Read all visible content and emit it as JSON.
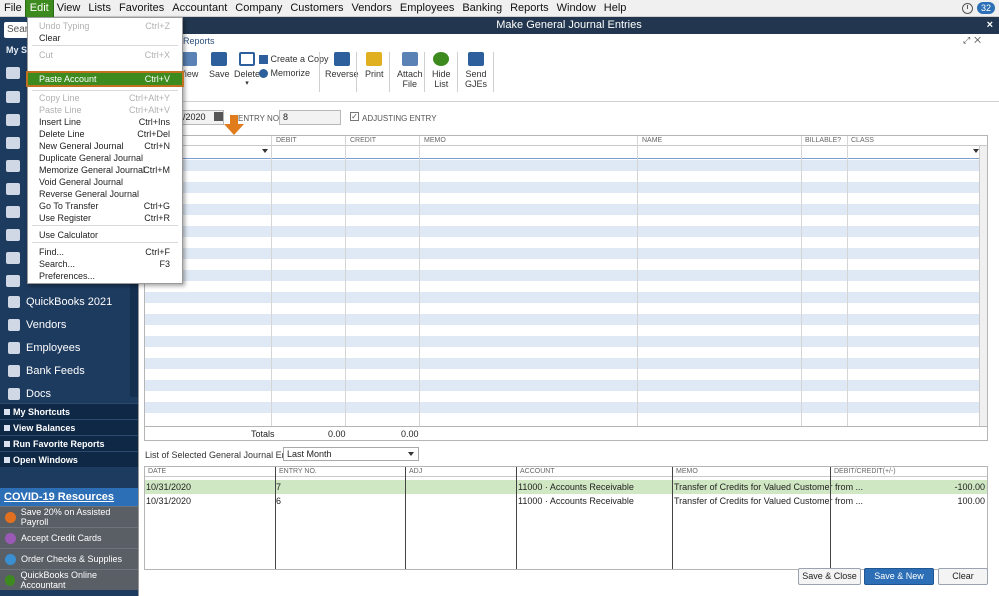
{
  "menubar": {
    "items": [
      "File",
      "Edit",
      "View",
      "Lists",
      "Favorites",
      "Accountant",
      "Company",
      "Customers",
      "Vendors",
      "Employees",
      "Banking",
      "Reports",
      "Window",
      "Help"
    ],
    "notifications": "32"
  },
  "leftnav": {
    "search_placeholder": "Searc",
    "header": "My Sh",
    "items": [
      "QuickBooks 2021",
      "Vendors",
      "Employees",
      "Bank Feeds",
      "Docs"
    ],
    "sections": [
      "My Shortcuts",
      "View Balances",
      "Run Favorite Reports",
      "Open Windows"
    ],
    "covid": "COVID-19 Resources",
    "promos": [
      "Save 20% on Assisted Payroll",
      "Accept Credit Cards",
      "Order Checks & Supplies",
      "QuickBooks Online Accountant"
    ]
  },
  "window": {
    "title": "Make General Journal Entries",
    "reports_tab": "Reports"
  },
  "toolbar": {
    "view": "View",
    "save": "Save",
    "delete": "Delete",
    "create_copy": "Create a Copy",
    "memorize": "Memorize",
    "reverse": "Reverse",
    "print": "Print",
    "attach_file_1": "Attach",
    "attach_file_2": "File",
    "hide_list_1": "Hide",
    "hide_list_2": "List",
    "send_gjes_1": "Send",
    "send_gjes_2": "GJEs"
  },
  "form": {
    "date_value": "/2020",
    "entry_no_label": "ENTRY NO.",
    "entry_no_value": "8",
    "adjusting_label": "ADJUSTING ENTRY"
  },
  "grid": {
    "headers": [
      "DEBIT",
      "CREDIT",
      "MEMO",
      "NAME",
      "BILLABLE?",
      "CLASS"
    ],
    "totals_label": "Totals",
    "total_debit": "0.00",
    "total_credit": "0.00"
  },
  "list": {
    "label": "List of Selected General Journal Entries:",
    "filter": "Last Month",
    "headers": [
      "DATE",
      "ENTRY NO.",
      "ADJ",
      "ACCOUNT",
      "MEMO",
      "DEBIT/CREDIT(+/-)"
    ],
    "rows": [
      {
        "date": "10/31/2020",
        "entry": "7",
        "account": "11000 · Accounts Receivable",
        "memo": "Transfer of Credits for Valued Customer from ...",
        "amount": "-100.00"
      },
      {
        "date": "10/31/2020",
        "entry": "6",
        "account": "11000 · Accounts Receivable",
        "memo": "Transfer of Credits for Valued Customer from ...",
        "amount": "100.00"
      }
    ]
  },
  "buttons": {
    "save_close": "Save & Close",
    "save_new": "Save & New",
    "clear": "Clear"
  },
  "edit_menu": {
    "items": [
      {
        "label": "Undo Typing",
        "shortcut": "Ctrl+Z",
        "disabled": true
      },
      {
        "label": "Clear",
        "shortcut": "",
        "disabled": false
      },
      {
        "label": "Cut",
        "shortcut": "Ctrl+X",
        "disabled": true
      },
      {
        "label": "Paste Account",
        "shortcut": "Ctrl+V",
        "disabled": false
      },
      {
        "label": "Copy Line",
        "shortcut": "Ctrl+Alt+Y",
        "disabled": true
      },
      {
        "label": "Paste Line",
        "shortcut": "Ctrl+Alt+V",
        "disabled": true
      },
      {
        "label": "Insert Line",
        "shortcut": "Ctrl+Ins",
        "disabled": false
      },
      {
        "label": "Delete Line",
        "shortcut": "Ctrl+Del",
        "disabled": false
      },
      {
        "label": "New General Journal",
        "shortcut": "Ctrl+N",
        "disabled": false
      },
      {
        "label": "Duplicate General Journal",
        "shortcut": "",
        "disabled": false
      },
      {
        "label": "Memorize General Journal",
        "shortcut": "Ctrl+M",
        "disabled": false
      },
      {
        "label": "Void General Journal",
        "shortcut": "",
        "disabled": false
      },
      {
        "label": "Reverse General Journal",
        "shortcut": "",
        "disabled": false
      },
      {
        "label": "Go To Transfer",
        "shortcut": "Ctrl+G",
        "disabled": false
      },
      {
        "label": "Use Register",
        "shortcut": "Ctrl+R",
        "disabled": false
      },
      {
        "label": "Use Calculator",
        "shortcut": "",
        "disabled": false
      },
      {
        "label": "Find...",
        "shortcut": "Ctrl+F",
        "disabled": false
      },
      {
        "label": "Search...",
        "shortcut": "F3",
        "disabled": false
      },
      {
        "label": "Preferences...",
        "shortcut": "",
        "disabled": false
      }
    ]
  },
  "colors": {
    "nav_bg": "#1d3a5f",
    "highlight_green": "#3d8b1f",
    "highlight_border": "#c0721e",
    "primary_blue": "#2c6fb6",
    "row_stripe": "#dfe9f6",
    "selected_row": "#cfe7c3"
  }
}
